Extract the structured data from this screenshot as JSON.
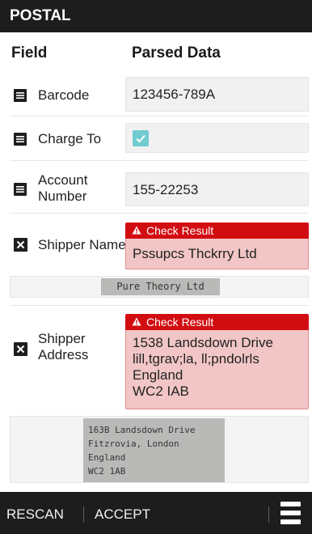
{
  "app": {
    "title": "POSTAL"
  },
  "header": {
    "field_label": "Field",
    "parsed_label": "Parsed Data"
  },
  "rows": [
    {
      "label": "Barcode",
      "icon": "document-icon",
      "value": "123456-789A"
    },
    {
      "label": "Charge To",
      "icon": "document-icon",
      "checked": true
    },
    {
      "label_line1": "Account",
      "label_line2": "Number",
      "icon": "document-icon",
      "value": "155-22253"
    },
    {
      "label": "Shipper Name",
      "icon": "x-box-icon",
      "alert": "Check Result",
      "value": "Pssupcs Thckrry Ltd",
      "scan_text": "Pure Theory Ltd"
    },
    {
      "label_line1": "Shipper",
      "label_line2": "Address",
      "icon": "x-box-icon",
      "alert": "Check Result",
      "value_lines": [
        "1538 Landsdown Drive",
        "lill,tgrav;la, ll;pndolrls",
        "England",
        "WC2 IAB"
      ],
      "scan_lines": [
        "163B Landsdown Drive",
        "Fitzrovia, London",
        "England",
        "WC2 1AB"
      ]
    }
  ],
  "footer": {
    "rescan": "RESCAN",
    "accept": "ACCEPT"
  },
  "colors": {
    "bar": "#1d1d1d",
    "alert": "#d20d11",
    "alert_bg": "#f2c6c6",
    "check": "#70ccd0"
  }
}
